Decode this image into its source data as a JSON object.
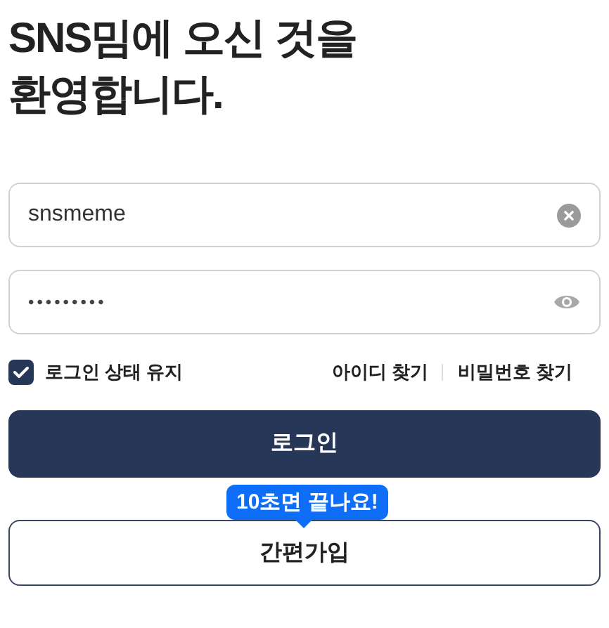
{
  "heading_lines": [
    "SNS밈에 오신 것을",
    "환영합니다."
  ],
  "username": {
    "value": "snsmeme"
  },
  "password": {
    "value": "•••••••••"
  },
  "keep_logged_in": {
    "label": "로그인 상태 유지",
    "checked": true
  },
  "links": [
    "아이디 찾기",
    "비밀번호 찾기"
  ],
  "login_button": "로그인",
  "tooltip": "10초면 끝나요!",
  "signup_button": "간편가입"
}
